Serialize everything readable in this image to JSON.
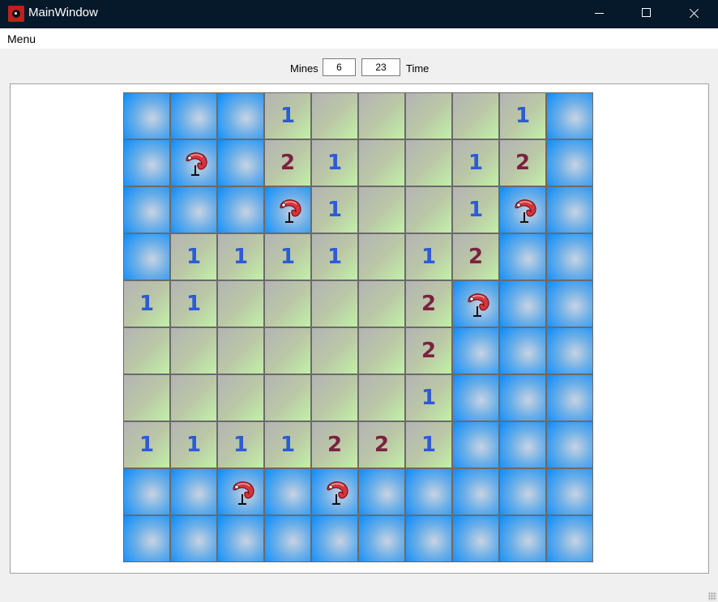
{
  "window": {
    "title": "MainWindow",
    "icon": "app-mine-icon"
  },
  "menubar": {
    "menu_label": "Menu"
  },
  "status": {
    "mines_label": "Mines",
    "mines_value": "6",
    "time_value": "23",
    "time_label": "Time"
  },
  "colors": {
    "one": "#2c5bd6",
    "two": "#7a2240"
  },
  "board": {
    "rows": 10,
    "cols": 10,
    "legend": {
      "H": "hidden",
      "F": "flagged",
      "0": "empty",
      "1": "one",
      "2": "two"
    },
    "cells": [
      [
        "H",
        "H",
        "H",
        "1",
        "0",
        "0",
        "0",
        "0",
        "1",
        "H"
      ],
      [
        "H",
        "F",
        "H",
        "2",
        "1",
        "0",
        "0",
        "1",
        "2",
        "H"
      ],
      [
        "H",
        "H",
        "H",
        "F",
        "1",
        "0",
        "0",
        "1",
        "F",
        "H"
      ],
      [
        "H",
        "1",
        "1",
        "1",
        "1",
        "0",
        "1",
        "2",
        "H",
        "H"
      ],
      [
        "1",
        "1",
        "0",
        "0",
        "0",
        "0",
        "2",
        "F",
        "H",
        "H"
      ],
      [
        "0",
        "0",
        "0",
        "0",
        "0",
        "0",
        "2",
        "H",
        "H",
        "H"
      ],
      [
        "0",
        "0",
        "0",
        "0",
        "0",
        "0",
        "1",
        "H",
        "H",
        "H"
      ],
      [
        "1",
        "1",
        "1",
        "1",
        "2",
        "2",
        "1",
        "H",
        "H",
        "H"
      ],
      [
        "H",
        "H",
        "F",
        "H",
        "F",
        "H",
        "H",
        "H",
        "H",
        "H"
      ],
      [
        "H",
        "H",
        "H",
        "H",
        "H",
        "H",
        "H",
        "H",
        "H",
        "H"
      ]
    ]
  }
}
